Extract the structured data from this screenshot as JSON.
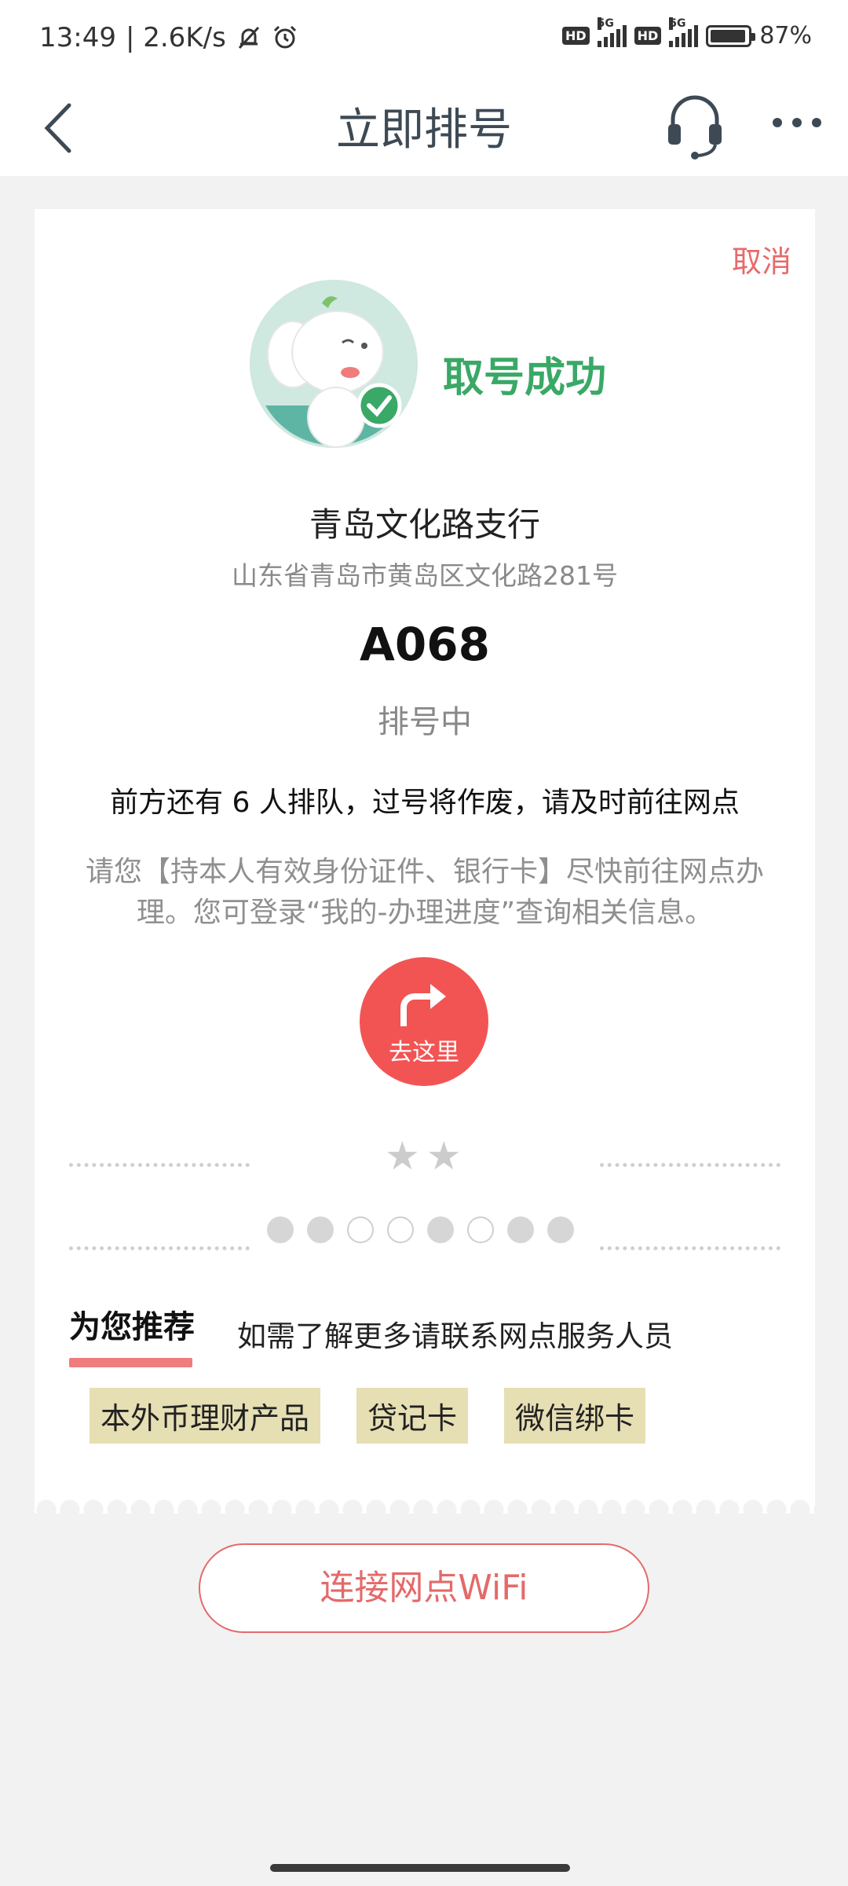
{
  "status_bar": {
    "time": "13:49",
    "speed": "| 2.6K/s",
    "hd1": "HD",
    "sim1_label": "5G",
    "hd2": "HD",
    "sim2_label": "5G",
    "battery": "87%",
    "icons": [
      "mute-bell-icon",
      "alarm-icon",
      "signal-icon",
      "battery-icon"
    ]
  },
  "nav": {
    "title": "立即排号",
    "icons": [
      "back-arrow-icon",
      "headset-icon",
      "more-dots-icon"
    ]
  },
  "ticket": {
    "cancel": "取消",
    "success": "取号成功",
    "branch_name": "青岛文化路支行",
    "branch_address": "山东省青岛市黄岛区文化路281号",
    "number": "A068",
    "status": "排号中",
    "queue_info": "前方还有 6 人排队，过号将作废，请及时前往网点",
    "notice": "请您【持本人有效身份证件、银行卡】尽快前往网点办理。您可登录“我的-办理进度”查询相关信息。",
    "go_label": "去这里",
    "stars": "★★",
    "brand_colors": {
      "success": "#3aa866",
      "accent": "#f25454"
    }
  },
  "recommend": {
    "title": "为您推荐",
    "hint": "如需了解更多请联系网点服务人员",
    "tags": [
      "本外币理财产品",
      "贷记卡",
      "微信绑卡"
    ]
  },
  "wifi_button": "连接网点WiFi"
}
